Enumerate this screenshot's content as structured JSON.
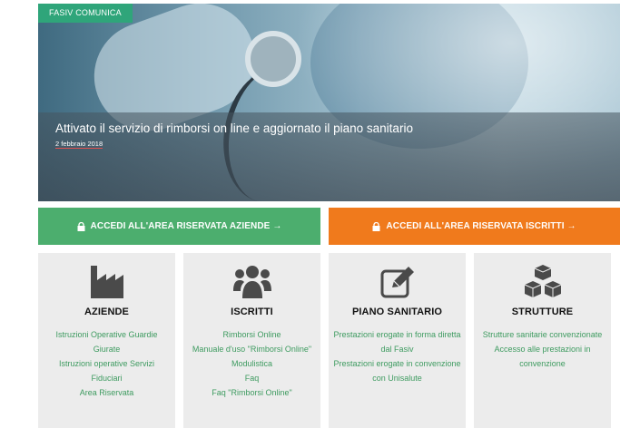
{
  "hero": {
    "tag": "FASIV COMUNICA",
    "title": "Attivato il servizio di rimborsi on line e aggiornato il piano sanitario",
    "date": "2 febbraio 2018"
  },
  "buttons": {
    "aziende": "ACCEDI ALL'AREA RISERVATA AZIENDE →",
    "iscritti": "ACCEDI ALL'AREA RISERVATA ISCRITTI →"
  },
  "cards": {
    "aziende": {
      "icon": "factory-icon",
      "title": "AZIENDE",
      "links": [
        "Istruzioni Operative Guardie Giurate",
        "Istruzioni operative Servizi Fiduciari",
        "Area Riservata"
      ]
    },
    "iscritti": {
      "icon": "users-icon",
      "title": "ISCRITTI",
      "links": [
        "Rimborsi Online",
        "Manuale d'uso \"Rimborsi Online\"",
        "Modulistica",
        "Faq",
        "Faq \"Rimborsi Online\""
      ]
    },
    "piano": {
      "icon": "edit-icon",
      "title": "PIANO SANITARIO",
      "links": [
        "Prestazioni erogate in forma diretta dal Fasiv",
        "Prestazioni erogate in convenzione con Unisalute"
      ]
    },
    "strutture": {
      "icon": "cubes-icon",
      "title": "STRUTTURE",
      "links": [
        "Strutture sanitarie convenzionate",
        "Accesso alle prestazioni in convenzione"
      ]
    }
  },
  "colors": {
    "green": "#4cae6e",
    "orange": "#f07a1c",
    "tag_green": "#2fa57a",
    "link_green": "#3e9b60"
  }
}
